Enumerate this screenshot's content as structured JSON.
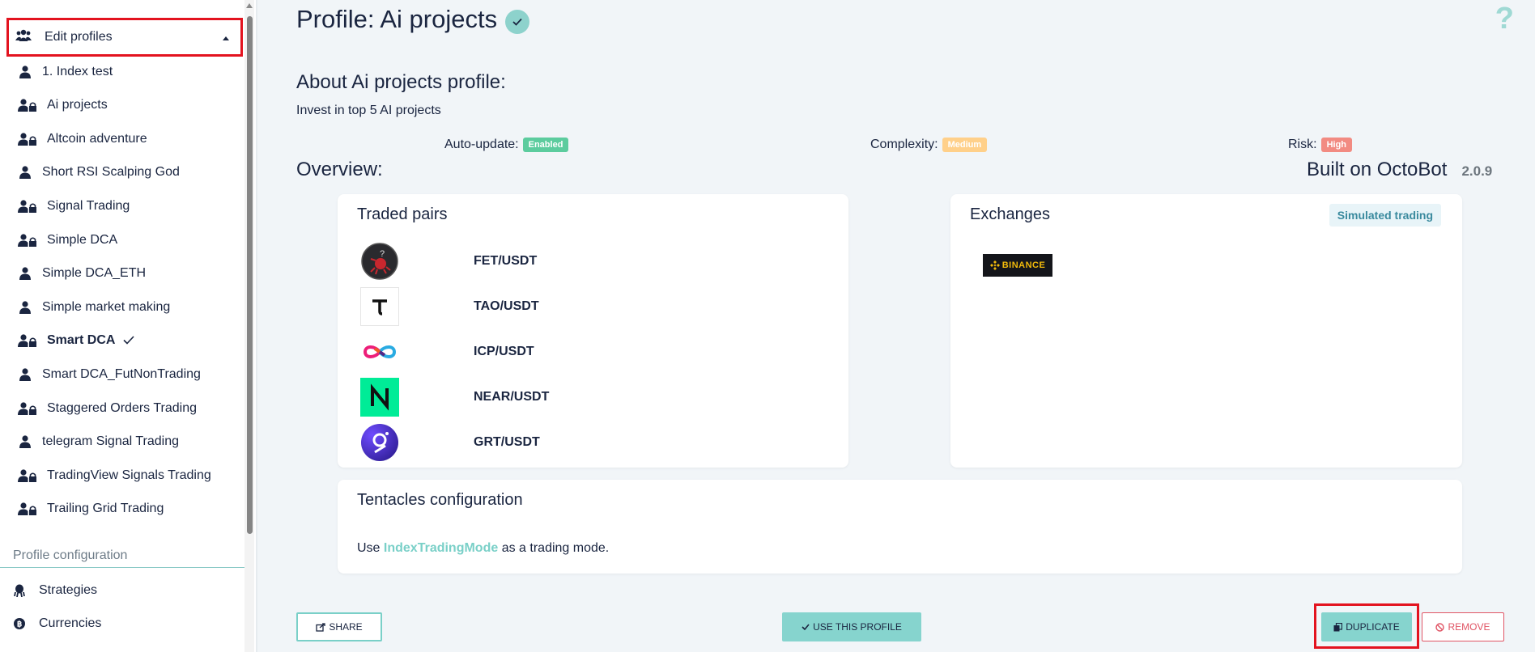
{
  "sidebar": {
    "header_label": "Edit profiles",
    "profiles": [
      {
        "label": "1. Index test",
        "locked": false,
        "active": false
      },
      {
        "label": "Ai projects",
        "locked": true,
        "active": false
      },
      {
        "label": "Altcoin adventure",
        "locked": true,
        "active": false
      },
      {
        "label": "Short RSI Scalping God",
        "locked": false,
        "active": false
      },
      {
        "label": "Signal Trading",
        "locked": true,
        "active": false
      },
      {
        "label": "Simple DCA",
        "locked": true,
        "active": false
      },
      {
        "label": "Simple DCA_ETH",
        "locked": false,
        "active": false
      },
      {
        "label": "Simple market making",
        "locked": false,
        "active": false
      },
      {
        "label": "Smart DCA",
        "locked": true,
        "active": true
      },
      {
        "label": "Smart DCA_FutNonTrading",
        "locked": false,
        "active": false
      },
      {
        "label": "Staggered Orders Trading",
        "locked": true,
        "active": false
      },
      {
        "label": "telegram Signal Trading",
        "locked": false,
        "active": false
      },
      {
        "label": "TradingView Signals Trading",
        "locked": true,
        "active": false
      },
      {
        "label": "Trailing Grid Trading",
        "locked": true,
        "active": false
      }
    ],
    "section_title": "Profile configuration",
    "config_items": [
      {
        "label": "Strategies",
        "icon": "octopus-icon"
      },
      {
        "label": "Currencies",
        "icon": "bitcoin-icon"
      }
    ]
  },
  "main": {
    "title": "Profile: Ai projects",
    "about_title": "About Ai projects profile:",
    "description": "Invest in top 5 AI projects",
    "auto_update_label": "Auto-update:",
    "auto_update_value": "Enabled",
    "complexity_label": "Complexity:",
    "complexity_value": "Medium",
    "risk_label": "Risk:",
    "risk_value": "High",
    "overview_title": "Overview:",
    "built_on": "Built on OctoBot",
    "version": "2.0.9",
    "traded_pairs_title": "Traded pairs",
    "pairs": [
      "FET/USDT",
      "TAO/USDT",
      "ICP/USDT",
      "NEAR/USDT",
      "GRT/USDT"
    ],
    "exchanges_title": "Exchanges",
    "simulated_badge": "Simulated trading",
    "exchange_logo_text": "BINANCE",
    "tentacles_title": "Tentacles configuration",
    "tentacles_prefix": "Use",
    "tentacles_mode": "IndexTradingMode",
    "tentacles_suffix": "as a trading mode.",
    "buttons": {
      "share": "SHARE",
      "use": "USE THIS PROFILE",
      "duplicate": "DUPLICATE",
      "remove": "REMOVE"
    }
  },
  "colors": {
    "accent": "#86d4ce",
    "enabled": "#5ccc9e",
    "medium": "#ffd08a",
    "high": "#f28b82",
    "highlight_frame": "#e3131f"
  }
}
